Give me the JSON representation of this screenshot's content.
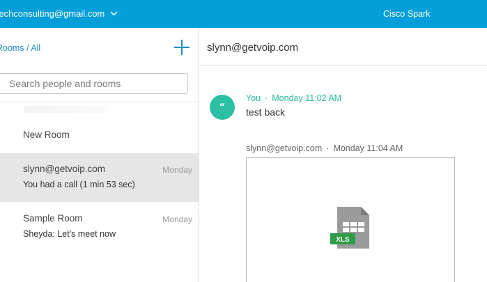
{
  "topbar": {
    "account": "rechconsulting@gmail.com",
    "app_title": "Cisco Spark"
  },
  "sidebar": {
    "breadcrumb": "Rooms / All",
    "search_placeholder": "Search people and rooms",
    "rooms": [
      {
        "name": "New Room",
        "date": "",
        "last_message": ""
      },
      {
        "name": "slynn@getvoip.com",
        "date": "Monday",
        "last_message": "You had a call (1 min 53 sec)",
        "selected": true
      },
      {
        "name": "Sample Room",
        "date": "Monday",
        "last_message": "Sheyda: Let's meet now"
      }
    ]
  },
  "conversation": {
    "title": "slynn@getvoip.com",
    "messages": [
      {
        "avatar": "“",
        "sender": "You",
        "time": "Monday 11:02 AM",
        "text": "test back"
      },
      {
        "sender": "slynn@getvoip.com",
        "time": "Monday 11:04 AM",
        "attachment_type": "XLS"
      }
    ]
  },
  "icons": {
    "account_menu": "chevron-down-icon",
    "new_room": "plus-icon",
    "file": "xls-file-icon"
  },
  "colors": {
    "topbar": "#049fd9",
    "accent": "#1a8fc7",
    "avatar": "#2bbfa4",
    "xls_green": "#2e9c47",
    "selected_row": "#e6e6e6"
  }
}
